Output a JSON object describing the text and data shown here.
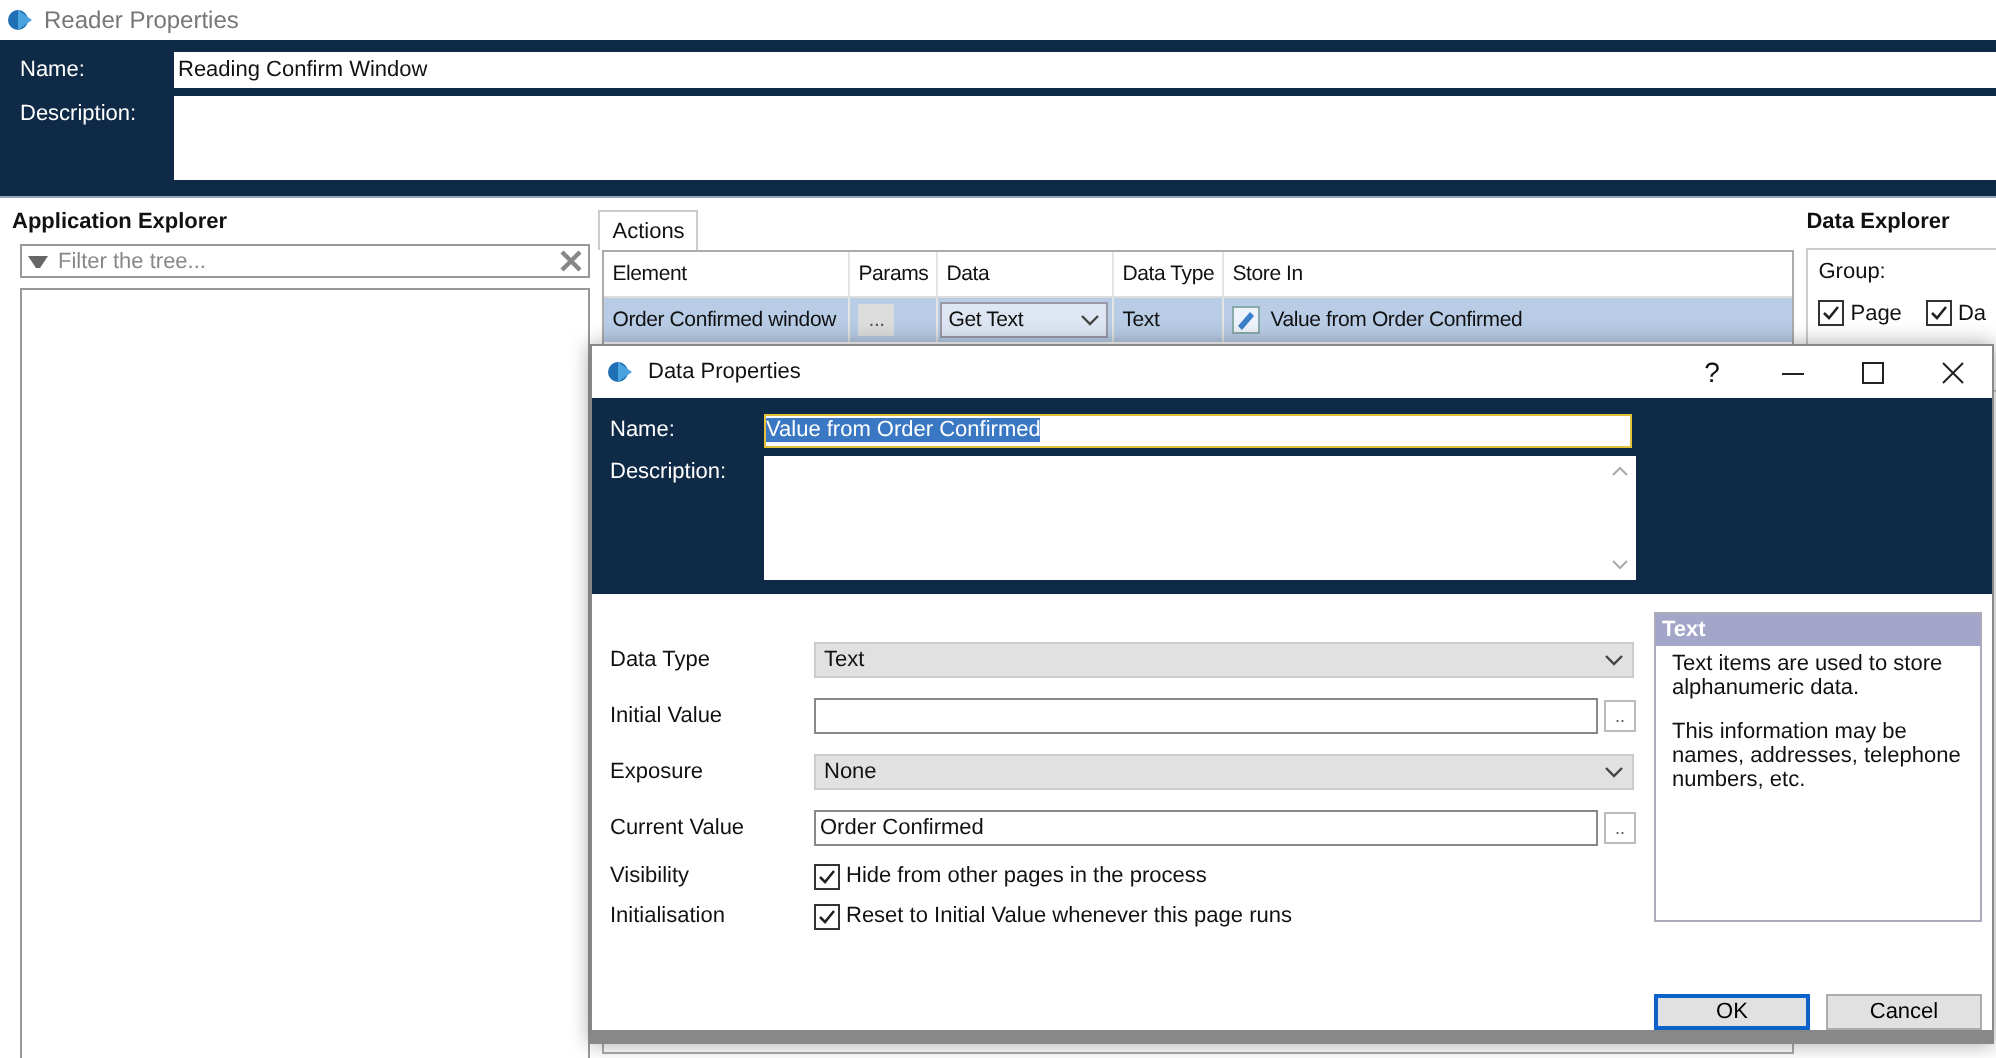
{
  "window": {
    "title": "Reader Properties"
  },
  "header": {
    "name_label": "Name:",
    "name_value": "Reading Confirm Window",
    "description_label": "Description:"
  },
  "application_explorer": {
    "title": "Application Explorer",
    "filter_placeholder": "Filter the tree..."
  },
  "actions": {
    "tabs": [
      {
        "label": "Actions",
        "selected": true
      }
    ],
    "columns": [
      "Element",
      "Params",
      "Data",
      "Data Type",
      "Store In"
    ],
    "rows": [
      {
        "element": "Order Confirmed window",
        "params": "...",
        "data": "Get Text",
        "data_type": "Text",
        "store_in": "Value from Order Confirmed",
        "selected": true
      }
    ]
  },
  "data_explorer": {
    "title": "Data Explorer",
    "group_label": "Group:",
    "options": [
      {
        "label": "Page",
        "checked": true
      },
      {
        "label": "Da",
        "checked": true
      }
    ]
  },
  "dialog": {
    "title": "Data Properties",
    "help": "?",
    "name_label": "Name:",
    "name_value": "Value from Order Confirmed",
    "description_label": "Description:",
    "fields": [
      {
        "kind": "select",
        "label": "Data Type",
        "value": "Text"
      },
      {
        "kind": "input",
        "label": "Initial Value",
        "browse": ".."
      },
      {
        "kind": "select",
        "label": "Exposure",
        "value": "None"
      },
      {
        "kind": "input",
        "label": "Current Value",
        "value": "Order Confirmed",
        "browse": ".."
      },
      {
        "kind": "checkbox",
        "label": "Visibility",
        "text": "Hide from other pages in the process",
        "checked": true
      },
      {
        "kind": "checkbox",
        "label": "Initialisation",
        "text": "Reset to Initial Value whenever this page runs",
        "checked": true
      }
    ],
    "info": {
      "title": "Text",
      "paragraphs": [
        "Text items are used to store alphanumeric data.",
        "This information may be names, addresses, telephone numbers, etc."
      ]
    },
    "buttons": [
      {
        "label": "OK",
        "default": true
      },
      {
        "label": "Cancel",
        "default": false
      }
    ]
  }
}
